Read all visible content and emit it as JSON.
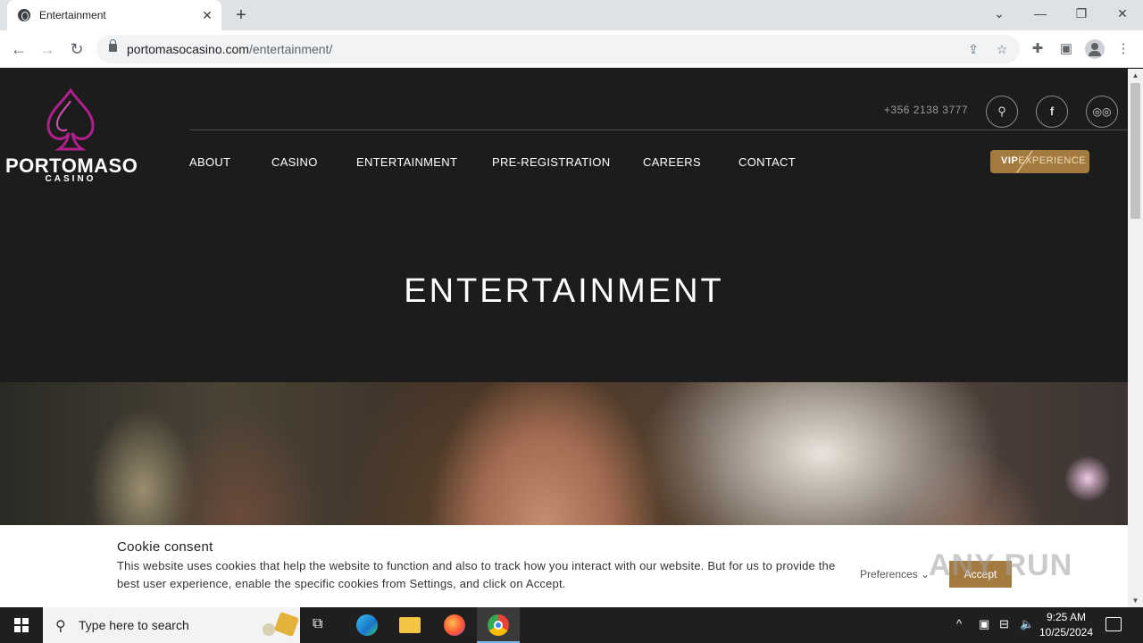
{
  "browser": {
    "tab_title": "Entertainment",
    "tab_close": "✕",
    "new_tab": "+",
    "url_domain": "portomasocasino.com",
    "url_path": "/entertainment/",
    "window_controls": {
      "list": "⌄",
      "minimize": "—",
      "restore": "❐",
      "close": "✕"
    }
  },
  "site": {
    "logo_name": "PORTOMASO",
    "logo_sub": "CASINO",
    "phone": "+356 2138 3777",
    "nav": [
      "ABOUT",
      "CASINO",
      "ENTERTAINMENT",
      "PRE-REGISTRATION",
      "CAREERS",
      "CONTACT"
    ],
    "vip_bold": "VIP",
    "vip_rest": "EXPERIENCE",
    "hero_title": "ENTERTAINMENT",
    "brand_color": "#a47b3f",
    "logo_color": "#b0208a"
  },
  "cookie": {
    "title": "Cookie consent",
    "text": "This website uses cookies that help the website to function and also to track how you interact with our website. But for us to provide the best user experience, enable the specific cookies from Settings, and click on Accept.",
    "preferences": "Preferences",
    "accept": "Accept",
    "watermark": "ANY RUN"
  },
  "taskbar": {
    "search_placeholder": "Type here to search",
    "time": "9:25 AM",
    "date": "10/25/2024"
  }
}
